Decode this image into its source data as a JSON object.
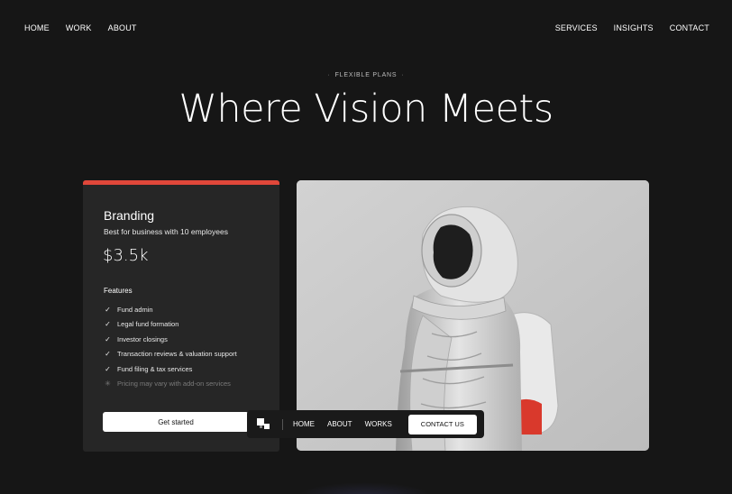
{
  "nav": {
    "left": [
      "HOME",
      "WORK",
      "ABOUT"
    ],
    "right": [
      "SERVICES",
      "INSIGHTS",
      "CONTACT"
    ]
  },
  "hero": {
    "eyebrow": "FLEXIBLE PLANS",
    "title": "Where Vision Meets"
  },
  "plan": {
    "name": "Branding",
    "subtitle": "Best for business with 10 employees",
    "price": "$3.5k",
    "features_title": "Features",
    "features": [
      "Fund admin",
      "Legal fund formation",
      "Investor closings",
      "Transaction reviews & valuation support",
      "Fund filing & tax services"
    ],
    "note": "Pricing may vary with add-on services",
    "cta": "Get started",
    "accent_color": "#e0473a"
  },
  "floating_nav": {
    "links": [
      "HOME",
      "ABOUT",
      "WORKS"
    ],
    "cta": "CONTACT US"
  },
  "icons": {
    "feature": "check-icon",
    "note": "asterisk-icon",
    "logo": "pixel-logo-icon"
  }
}
